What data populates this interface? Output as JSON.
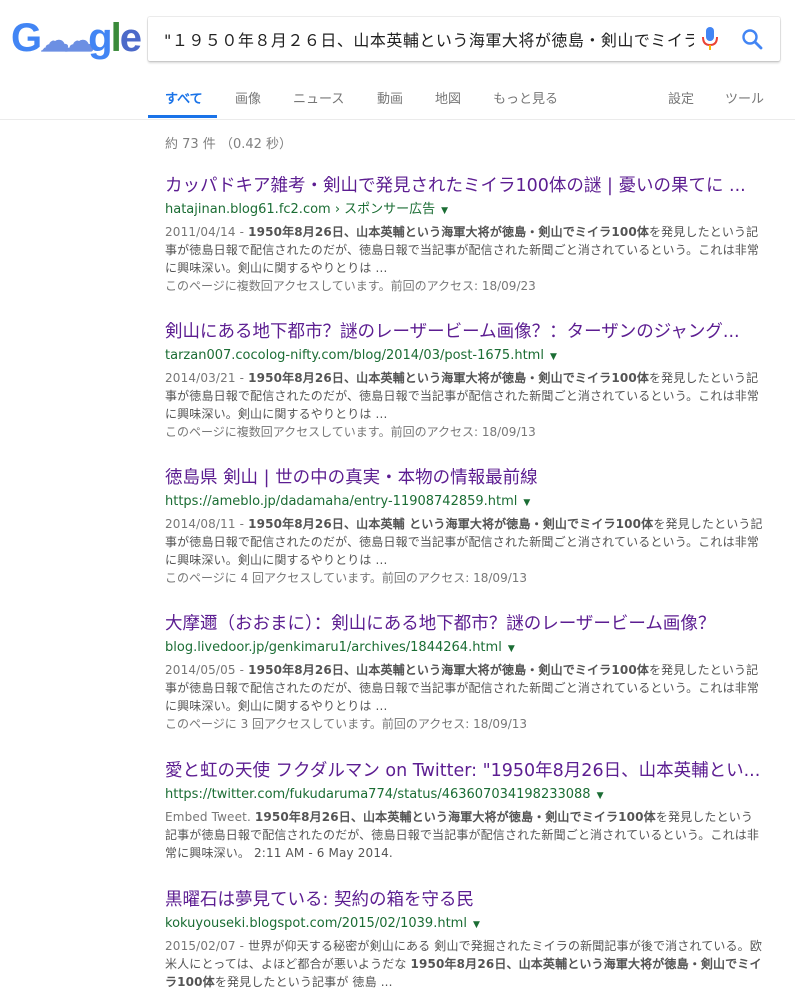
{
  "logo": {
    "g": "G",
    "cloud": "☁☁",
    "g2": "g",
    "l": "l",
    "e": "e"
  },
  "search": {
    "query": "\"１９５０年８月２６日、山本英輔という海軍大将が徳島・剣山でミイラ"
  },
  "tabs": {
    "all": "すべて",
    "images": "画像",
    "news": "ニュース",
    "videos": "動画",
    "maps": "地図",
    "more": "もっと見る",
    "settings": "設定",
    "tools": "ツール"
  },
  "stats": "約 73 件 （0.42 秒）",
  "results": [
    {
      "title": "カッパドキア雑考・剣山で発見されたミイラ100体の謎 | 憂いの果てに ...",
      "url": "hatajinan.blog61.fc2.com › スポンサー広告",
      "date": "2011/04/14 - ",
      "bold": "1950年8月26日、山本英輔という海軍大将が徳島・剣山でミイラ100体",
      "rest": "を発見したという記事が徳島日報で配信されたのだが、徳島日報で当記事が配信された新聞ごと消されているという。これは非常に興味深い。剣山に関するやりとりは ...",
      "visit": "このページに複数回アクセスしています。前回のアクセス: 18/09/23"
    },
    {
      "title": "剣山にある地下都市？謎のレーザービーム画像？：ターザンのジャング...",
      "url": "tarzan007.cocolog-nifty.com/blog/2014/03/post-1675.html",
      "date": "2014/03/21 - ",
      "bold": "1950年8月26日、山本英輔という海軍大将が徳島・剣山でミイラ100体",
      "rest": "を発見したという記事が徳島日報で配信されたのだが、徳島日報で当記事が配信された新聞ごと消されているという。これは非常に興味深い。剣山に関するやりとりは ...",
      "visit": "このページに複数回アクセスしています。前回のアクセス: 18/09/13"
    },
    {
      "title": "徳島県 剣山 | 世の中の真実・本物の情報最前線",
      "url": "https://ameblo.jp/dadamaha/entry-11908742859.html",
      "date": "2014/08/11 - ",
      "bold": "1950年8月26日、山本英輔 という海軍大将が徳島・剣山でミイラ100体",
      "rest": "を発見したという記事が徳島日報で配信されたのだが、徳島日報で当記事が配信された新聞ごと消されているという。これは非常に興味深い。剣山に関するやりとりは ...",
      "visit": "このページに 4 回アクセスしています。前回のアクセス: 18/09/13"
    },
    {
      "title": "大摩邇（おおまに）：剣山にある地下都市？謎のレーザービーム画像？",
      "url": "blog.livedoor.jp/genkimaru1/archives/1844264.html",
      "date": "2014/05/05 - ",
      "bold": "1950年8月26日、山本英輔という海軍大将が徳島・剣山でミイラ100体",
      "rest": "を発見したという記事が徳島日報で配信されたのだが、徳島日報で当記事が配信された新聞ごと消されているという。これは非常に興味深い。剣山に関するやりとりは ...",
      "visit": "このページに 3 回アクセスしています。前回のアクセス: 18/09/13"
    },
    {
      "title": "愛と虹の天使 フクダルマン on Twitter: \"1950年8月26日、山本英輔とい...",
      "url": "https://twitter.com/fukudaruma774/status/463607034198233088",
      "date": "Embed Tweet. ",
      "bold": "1950年8月26日、山本英輔という海軍大将が徳島・剣山でミイラ100体",
      "rest": "を発見したという記事が徳島日報で配信されたのだが、徳島日報で当記事が配信された新聞ごと消されているという。これは非常に興味深い。 2:11 AM - 6 May 2014.",
      "visit": ""
    },
    {
      "title": "黒曜石は夢見ている: 契約の箱を守る民",
      "url": "kokuyouseki.blogspot.com/2015/02/1039.html",
      "date": "2015/02/07 - ",
      "bold": "",
      "rest": "世界が仰天する秘密が剣山にある 剣山で発掘されたミイラの新聞記事が後で消されている。欧米人にとっては、よほど都合が悪いようだな ",
      "bold2": "1950年8月26日、山本英輔という海軍大将が徳島・剣山でミイラ100体",
      "rest2": "を発見したという記事が 徳島 ...",
      "visit": ""
    }
  ],
  "colors": {
    "title": "#5c1d91",
    "url": "#1b6d34",
    "accent": "#1a73e8"
  }
}
